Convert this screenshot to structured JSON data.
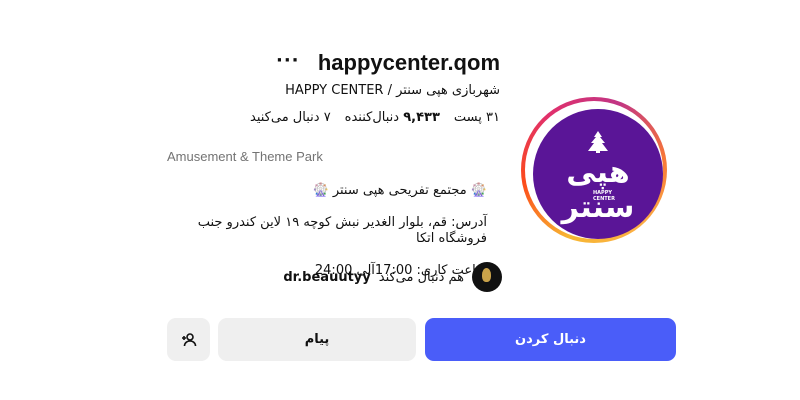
{
  "profile": {
    "username": "happycenter.qom",
    "more_label": "···",
    "full_name": "شهربازی هپی سنتر / HAPPY CENTER",
    "avatar_logo_text": "هپی سنتر",
    "avatar_logo_en": "HAPPY\nCENTER"
  },
  "stats": {
    "posts": "۳۱ پست",
    "followers_count": "۹,۴۳۳",
    "followers_label": "دنبال‌کننده",
    "following": "۷ دنبال می‌کنید"
  },
  "bio": {
    "category": "Amusement & Theme Park",
    "line1": "🎡 مجتمع تفریحی هپی سنتر 🎡",
    "line2": "آدرس: قم، بلوار الغدیر نبش کوچه ۱۹ لاین کندرو جنب فروشگاه اتکا",
    "line3": "ساعت کاری: 17:00آلی 24:00"
  },
  "mutual": {
    "prefix": "هم دنبال می‌کند",
    "username": "dr.beauutyy"
  },
  "actions": {
    "follow_label": "دنبال کردن",
    "message_label": "پیام",
    "suggest_icon": "add-person-icon"
  },
  "colors": {
    "follow_button": "#4a5df9",
    "secondary_button": "#efefef",
    "avatar_bg": "#5a1597",
    "category_text": "#737373"
  }
}
